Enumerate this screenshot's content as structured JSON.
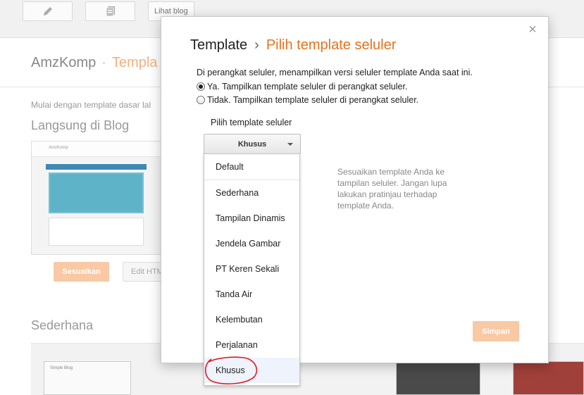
{
  "background": {
    "toolbar": {
      "view_blog_label": "Lihat blog"
    },
    "blog_name": "AmzKomp",
    "separator": "·",
    "breadcrumb": "Templa",
    "intro_text": "Mulai dengan template dasar lal",
    "live_section_title": "Langsung di Blog",
    "live_thumb_brand": "AmzKomp",
    "customize_label": "Sesuaikan",
    "edit_html_label": "Edit HTM",
    "simple_section_title": "Sederhana",
    "thumb_text": "Simple Blog"
  },
  "dialog": {
    "close_icon": "×",
    "title": "Template",
    "title_separator": "›",
    "subtitle": "Pilih template seluler",
    "description": "Di perangkat seluler, menampilkan versi seluler template Anda saat ini.",
    "options": [
      {
        "label": "Ya. Tampilkan template seluler di perangkat seluler.",
        "checked": true
      },
      {
        "label": "Tidak. Tampilkan template seluler di perangkat seluler.",
        "checked": false
      }
    ],
    "select_label": "Pilih template seluler",
    "selected_value": "Khusus",
    "menu_items": [
      "Default",
      "Sederhana",
      "Tampilan Dinamis",
      "Jendela Gambar",
      "PT Keren Sekali",
      "Tanda Air",
      "Kelembutan",
      "Perjalanan",
      "Khusus"
    ],
    "side_note": "Sesuaikan template Anda ke tampilan seluler. Jangan lupa lakukan pratinjau terhadap template Anda.",
    "save_label": "Simpan"
  },
  "colors": {
    "accent_orange": "#e8711a",
    "button_orange_faded": "#f8c9a4",
    "annotation_red": "#e0191f",
    "selected_item_bg": "#eef3fc"
  },
  "icons": [
    "pencil-icon",
    "posts-icon",
    "close-icon",
    "caret-down-icon"
  ]
}
